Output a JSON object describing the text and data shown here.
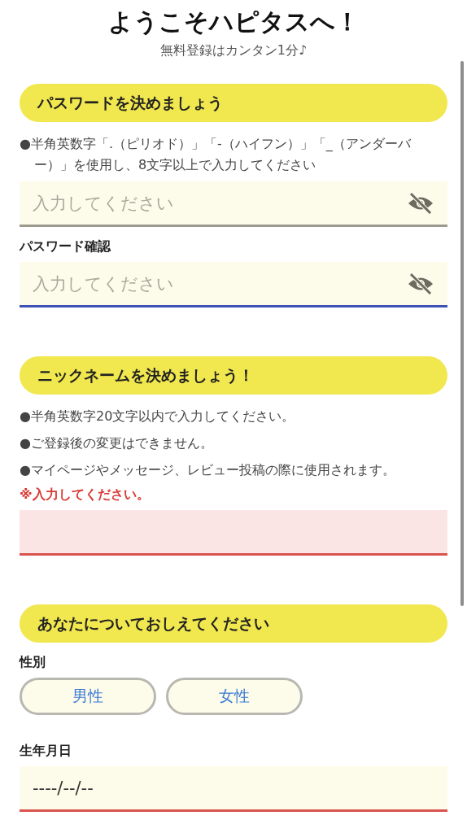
{
  "title": "ようこそハピタスへ！",
  "subtitle": "無料登録はカンタン1分♪",
  "sections": [
    {
      "heading": "パスワードを決めましょう",
      "items": [
        {
          "kind": "note",
          "text": "●半角英数字「.（ピリオド）」「-（ハイフン）」「_（アンダーバー）」を使用し、8文字以上で入力してください"
        },
        {
          "kind": "field",
          "placeholder": "入力してください",
          "focused": false,
          "invalid": false,
          "highlighted": false,
          "reveal_toggle": true
        },
        {
          "kind": "label",
          "text": "パスワード確認"
        },
        {
          "kind": "field",
          "placeholder": "入力してください",
          "focused": true,
          "invalid": false,
          "highlighted": false,
          "reveal_toggle": true
        }
      ]
    },
    {
      "heading": "ニックネームを決めましょう！",
      "items": [
        {
          "kind": "note",
          "text": "●半角英数字20文字以内で入力してください。"
        },
        {
          "kind": "note",
          "text": "●ご登録後の変更はできません。"
        },
        {
          "kind": "note",
          "text": "●マイページやメッセージ、レビュー投稿の際に使用されます。"
        },
        {
          "kind": "error",
          "text": "※入力してください。"
        },
        {
          "kind": "field",
          "invalid": true,
          "highlighted": true,
          "reveal_toggle": false
        }
      ]
    },
    {
      "heading": "あなたについておしえてください",
      "items": [
        {
          "kind": "label",
          "text": "性別"
        },
        {
          "kind": "choices",
          "options": [
            {
              "label": "男性",
              "selected": false
            },
            {
              "label": "女性",
              "selected": false
            }
          ]
        },
        {
          "kind": "label",
          "text": "生年月日"
        },
        {
          "kind": "field",
          "value": "----/--/--",
          "invalid": true,
          "highlighted": false,
          "reveal_toggle": false
        }
      ]
    }
  ]
}
